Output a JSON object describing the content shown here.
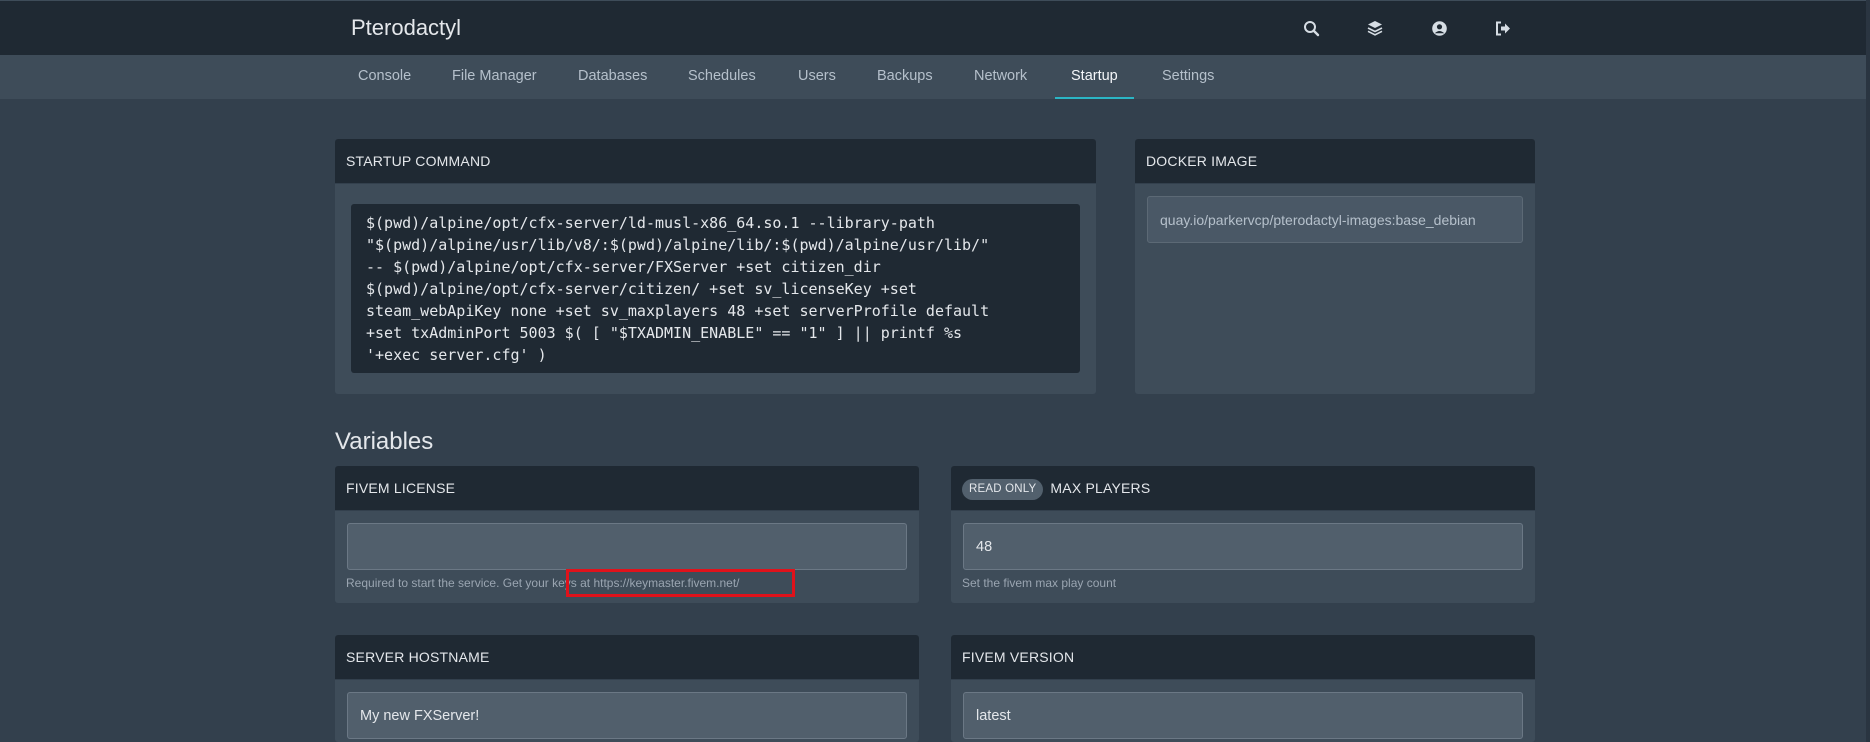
{
  "app": {
    "brand": "Pterodactyl"
  },
  "topbar_icons": [
    "search-icon",
    "layers-icon",
    "account-icon",
    "logout-icon"
  ],
  "tabs": [
    {
      "label": "Console"
    },
    {
      "label": "File Manager"
    },
    {
      "label": "Databases"
    },
    {
      "label": "Schedules"
    },
    {
      "label": "Users"
    },
    {
      "label": "Backups"
    },
    {
      "label": "Network"
    },
    {
      "label": "Startup"
    },
    {
      "label": "Settings"
    }
  ],
  "active_tab": "Startup",
  "startup": {
    "title": "STARTUP COMMAND",
    "command_lines": [
      "$(pwd)/alpine/opt/cfx-server/ld-musl-x86_64.so.1 --library-path",
      "\"$(pwd)/alpine/usr/lib/v8/:$(pwd)/alpine/lib/:$(pwd)/alpine/usr/lib/\"",
      "-- $(pwd)/alpine/opt/cfx-server/FXServer +set citizen_dir",
      "$(pwd)/alpine/opt/cfx-server/citizen/ +set sv_licenseKey +set",
      "steam_webApiKey none +set sv_maxplayers 48 +set serverProfile default",
      "+set txAdminPort 5003 $( [ \"$TXADMIN_ENABLE\" == \"1\" ] || printf %s",
      "'+exec server.cfg' )"
    ]
  },
  "docker": {
    "title": "DOCKER IMAGE",
    "value": "quay.io/parkervcp/pterodactyl-images:base_debian"
  },
  "variables": {
    "title": "Variables",
    "fivem_license": {
      "title": "FIVEM LICENSE",
      "value": "",
      "help_prefix": "Required to start the service. Get your",
      "help_link": "keys at https://keymaster.fivem.net/"
    },
    "max_players": {
      "badge": "READ ONLY",
      "title": "MAX PLAYERS",
      "value": "48",
      "help": "Set the fivem max play count"
    },
    "server_hostname": {
      "title": "SERVER HOSTNAME",
      "value": "My new FXServer!"
    },
    "fivem_version": {
      "title": "FIVEM VERSION",
      "value": "latest"
    }
  },
  "colors": {
    "background": "#33404d",
    "header": "#1f2933",
    "accent": "#2bb5c5",
    "highlight": "#e0121b"
  }
}
